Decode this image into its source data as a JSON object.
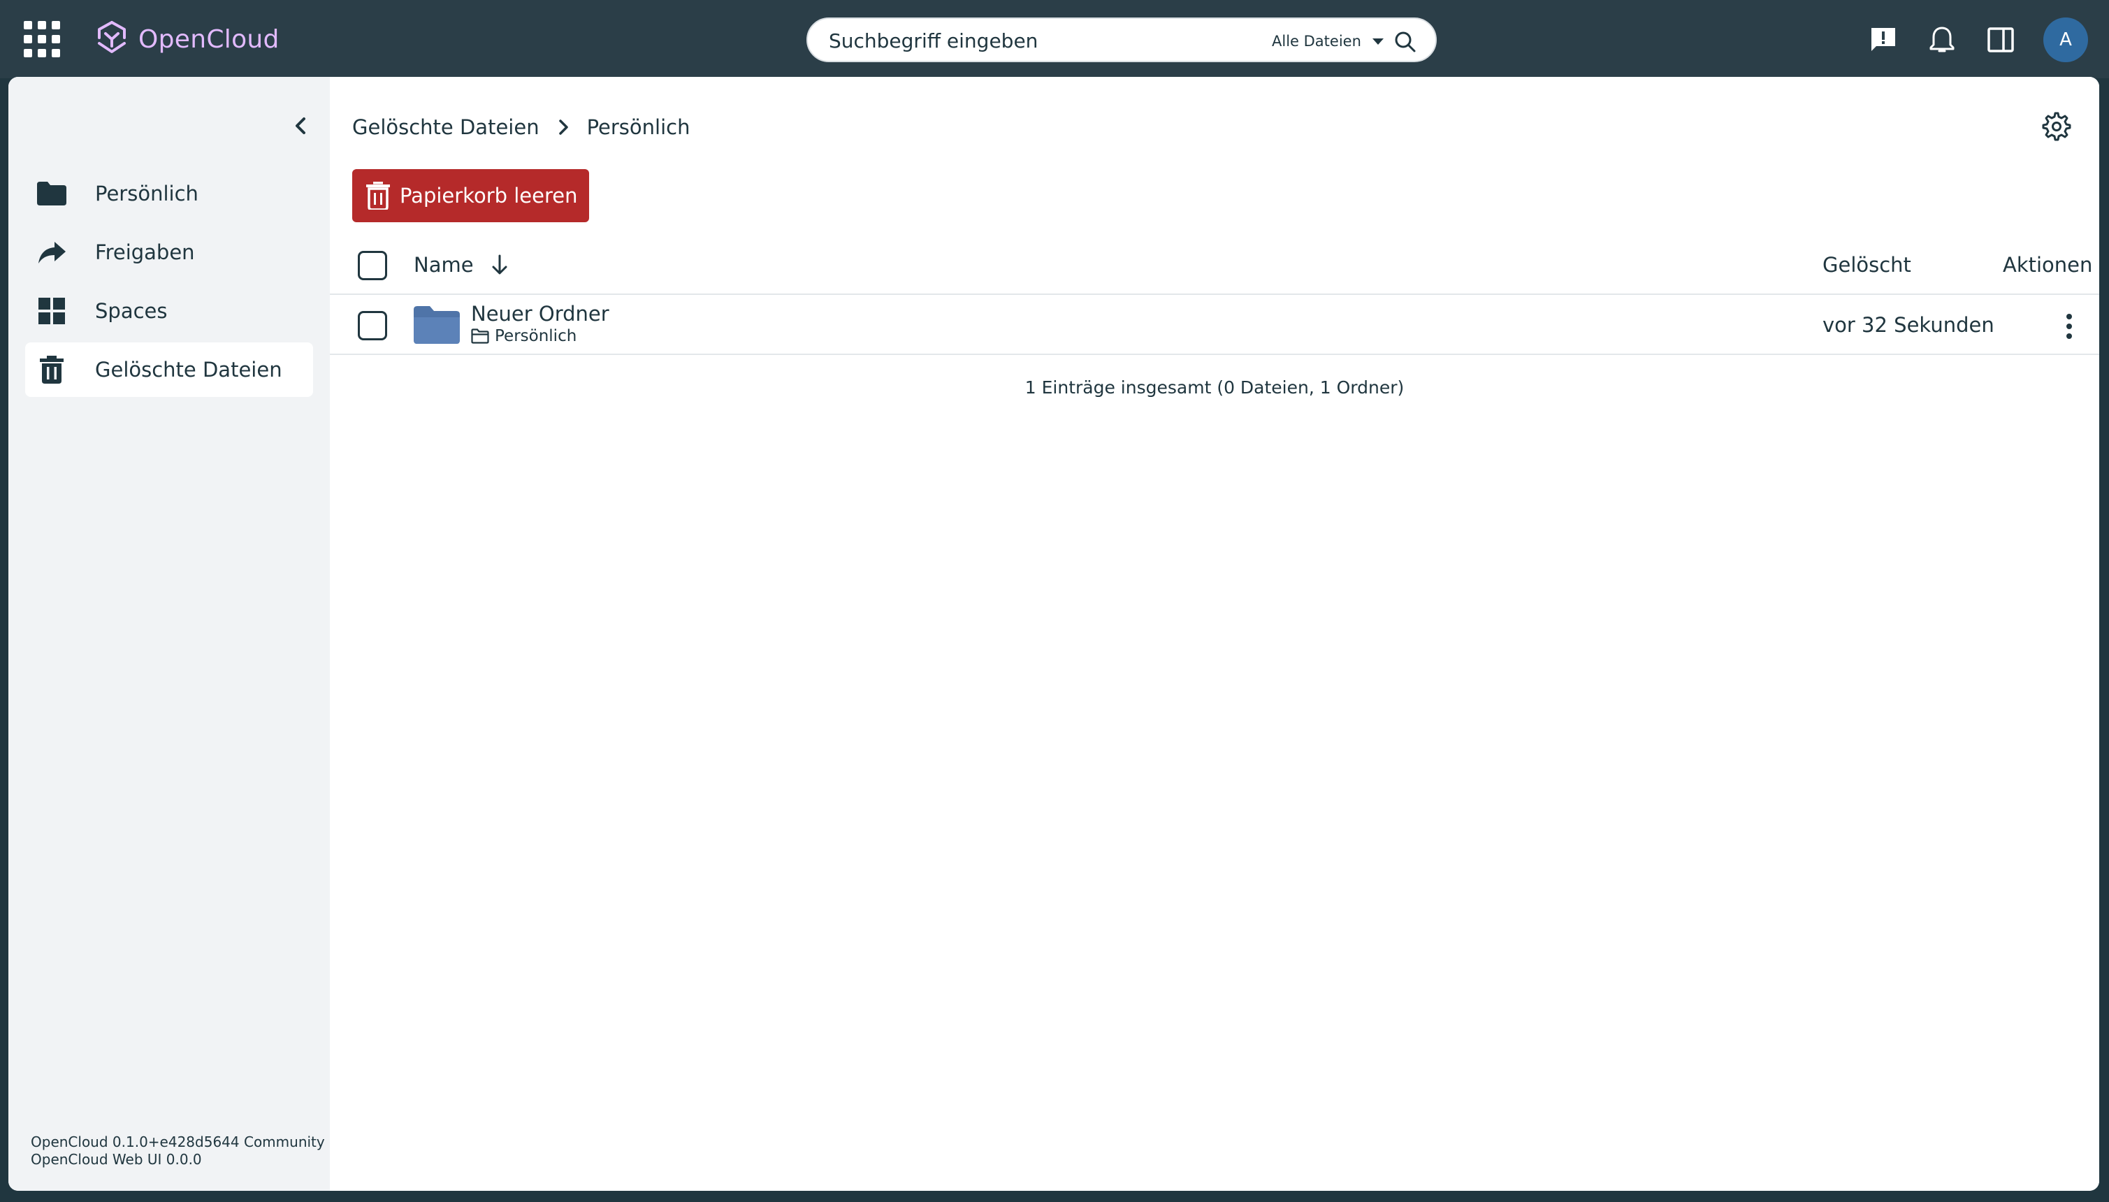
{
  "topbar": {
    "brand_name": "OpenCloud",
    "search": {
      "placeholder": "Suchbegriff eingeben",
      "scope": "Alle Dateien"
    },
    "avatar_initial": "A"
  },
  "sidebar": {
    "items": [
      {
        "label": "Persönlich",
        "icon": "folder-icon"
      },
      {
        "label": "Freigaben",
        "icon": "share-icon"
      },
      {
        "label": "Spaces",
        "icon": "grid-icon"
      },
      {
        "label": "Gelöschte Dateien",
        "icon": "trash-icon",
        "active": true
      }
    ],
    "version_line1": "OpenCloud 0.1.0+e428d5644 Community",
    "version_line2": "OpenCloud Web UI 0.0.0"
  },
  "main": {
    "breadcrumb": [
      "Gelöschte Dateien",
      "Persönlich"
    ],
    "empty_trash_label": "Papierkorb leeren",
    "columns": {
      "name": "Name",
      "deleted": "Gelöscht",
      "actions": "Aktionen"
    },
    "rows": [
      {
        "name": "Neuer Ordner",
        "location": "Persönlich",
        "deleted": "vor 32 Sekunden"
      }
    ],
    "summary": "1 Einträge insgesamt (0 Dateien, 1 Ordner)"
  },
  "colors": {
    "topbar": "#2b3e48",
    "brand": "#e2baff",
    "danger": "#b52a2a",
    "folder": "#4f74a8",
    "avatar": "#2f6aa0"
  }
}
